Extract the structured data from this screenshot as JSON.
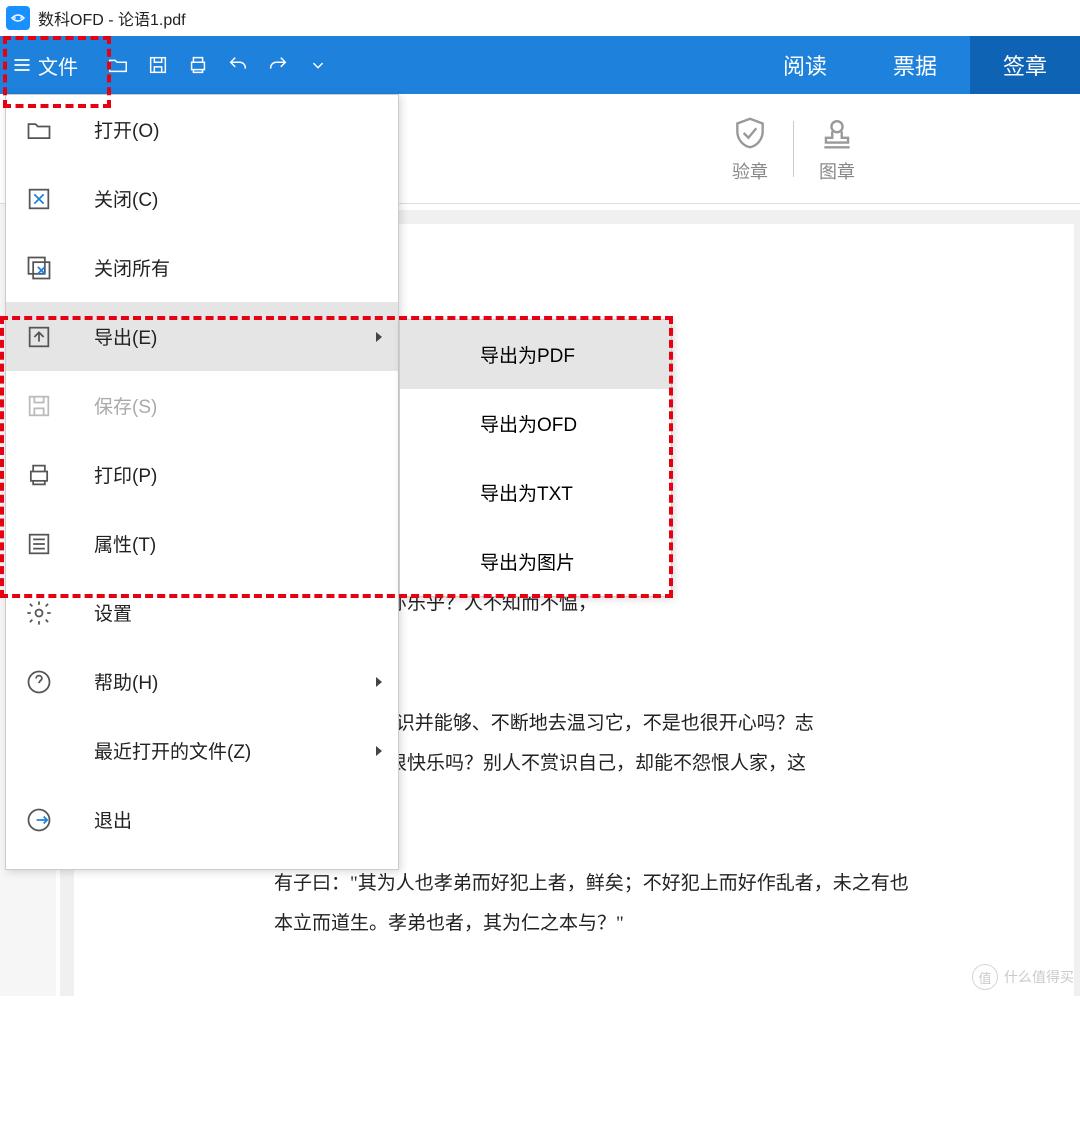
{
  "title": "数科OFD - 论语1.pdf",
  "toolbar": {
    "file_label": "文件"
  },
  "modes": {
    "read": "阅读",
    "invoice": "票据",
    "sign": "签章"
  },
  "sec": {
    "verify": "验章",
    "stamp": "图章"
  },
  "menu": {
    "open": "打开(O)",
    "close": "关闭(C)",
    "close_all": "关闭所有",
    "export": "导出(E)",
    "save": "保存(S)",
    "print": "打印(P)",
    "props": "属性(T)",
    "settings": "设置",
    "help": "帮助(H)",
    "recent": "最近打开的文件(Z)",
    "exit": "退出"
  },
  "submenu": {
    "pdf": "导出为PDF",
    "ofd": "导出为OFD",
    "txt": "导出为TXT",
    "img": "导出为图片"
  },
  "doc": {
    "p1": "自远方来，不亦乐乎？人不知而不愠，",
    "p2a": "下言：\"学了知识并能够、不断地去温习它，不是也很开心吗？志",
    "p2b": "访友，不是也很快乐吗？别人不赏识自己，却能不怨恨人家，这",
    "p3a": "有子曰：\"其为人也孝弟而好犯上者，鲜矣；不好犯上而好作乱者，未之有也",
    "p3b": "本立而道生。孝弟也者，其为仁之本与？\""
  },
  "watermark": {
    "char": "值",
    "text": "什么值得买"
  }
}
